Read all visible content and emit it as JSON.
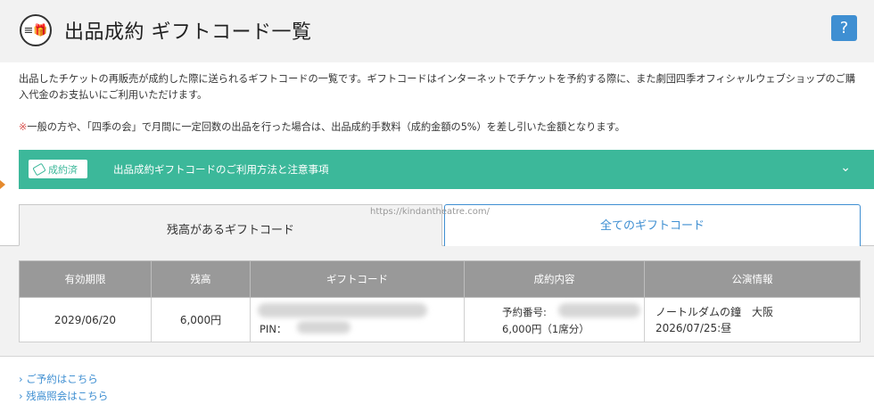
{
  "header": {
    "title": "出品成約 ギフトコード一覧",
    "help_label": "?"
  },
  "intro": "出品したチケットの再販売が成約した際に送られるギフトコードの一覧です。ギフトコードはインターネットでチケットを予約する際に、また劇団四季オフィシャルウェブショップのご購入代金のお支払いにご利用いただけます。",
  "notice": {
    "mark": "※",
    "text": "一般の方や、「四季の会」で月間に一定回数の出品を行った場合は、出品成約手数料（成約金額の5%）を差し引いた金額となります。"
  },
  "accordion": {
    "badge": "成約済",
    "label": "出品成約ギフトコードのご利用方法と注意事項",
    "chevron": "⌄"
  },
  "tabs": {
    "active": "残高があるギフトコード",
    "inactive": "全てのギフトコード"
  },
  "watermark": "https://kindantheatre.com/",
  "table": {
    "headers": [
      "有効期限",
      "残高",
      "ギフトコード",
      "成約内容",
      "公演情報"
    ],
    "row": {
      "expiry": "2029/06/20",
      "balance": "6,000円",
      "pin_label": "PIN：",
      "reservation_label": "予約番号:",
      "reservation_amount": "6,000円（1席分）",
      "performance_title": "ノートルダムの鐘　大阪",
      "performance_date": "2026/07/25:昼"
    }
  },
  "links": [
    "› ご予約はこちら",
    "› 残高照会はこちら"
  ],
  "colors": {
    "accent_green": "#3cb89a",
    "accent_blue": "#3f8fd2"
  }
}
